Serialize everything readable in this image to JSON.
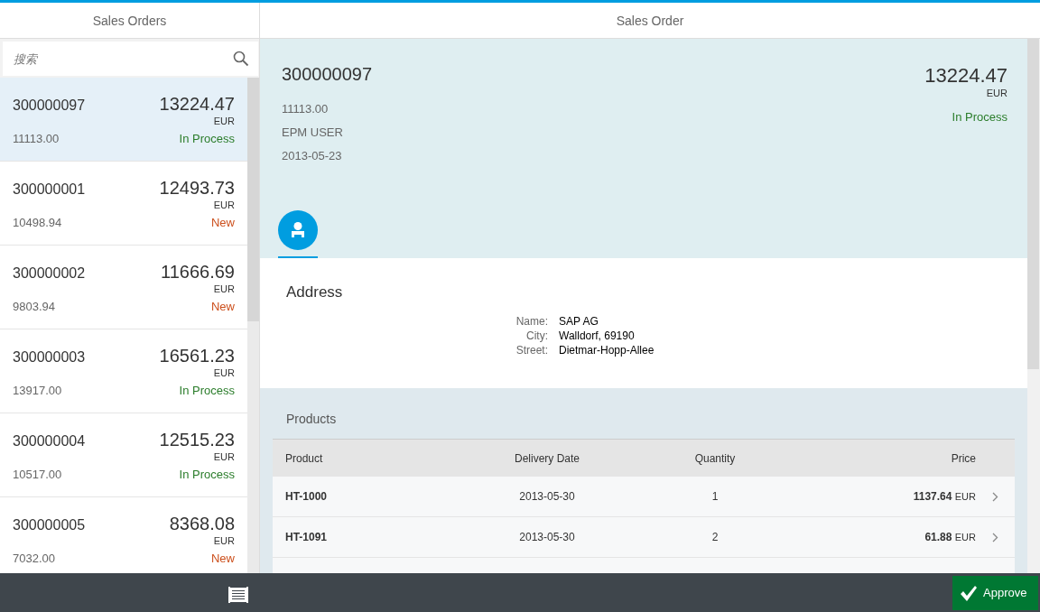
{
  "master": {
    "title": "Sales Orders",
    "search": {
      "placeholder": "搜索"
    },
    "items": [
      {
        "id": "300000097",
        "amount": "13224.47",
        "currency": "EUR",
        "net": "11113.00",
        "status": "In Process",
        "color": "#2b7d2b",
        "selected": true
      },
      {
        "id": "300000001",
        "amount": "12493.73",
        "currency": "EUR",
        "net": "10498.94",
        "status": "New",
        "color": "#cc4f1c",
        "selected": false
      },
      {
        "id": "300000002",
        "amount": "11666.69",
        "currency": "EUR",
        "net": "9803.94",
        "status": "New",
        "color": "#cc4f1c",
        "selected": false
      },
      {
        "id": "300000003",
        "amount": "16561.23",
        "currency": "EUR",
        "net": "13917.00",
        "status": "In Process",
        "color": "#2b7d2b",
        "selected": false
      },
      {
        "id": "300000004",
        "amount": "12515.23",
        "currency": "EUR",
        "net": "10517.00",
        "status": "In Process",
        "color": "#2b7d2b",
        "selected": false
      },
      {
        "id": "300000005",
        "amount": "8368.08",
        "currency": "EUR",
        "net": "7032.00",
        "status": "New",
        "color": "#cc4f1c",
        "selected": false
      }
    ]
  },
  "detail": {
    "title": "Sales Order",
    "header": {
      "id": "300000097",
      "amount": "13224.47",
      "currency": "EUR",
      "status": "In Process",
      "color": "#2b7d2b",
      "attributes": [
        "11113.00",
        "EPM USER",
        "2013-05-23"
      ]
    },
    "tabs": [
      {
        "kind": "contact",
        "selected": true
      }
    ],
    "address": {
      "title": "Address",
      "fields": [
        {
          "label": "Name:",
          "value": "SAP AG"
        },
        {
          "label": "City:",
          "value": "Walldorf, 69190"
        },
        {
          "label": "Street:",
          "value": "Dietmar-Hopp-Allee"
        }
      ]
    },
    "products": {
      "title": "Products",
      "columns": [
        "Product",
        "Delivery Date",
        "Quantity",
        "Price"
      ],
      "rows": [
        {
          "product": "HT-1000",
          "date": "2013-05-30",
          "quantity": "1",
          "price": "1137.64",
          "currency": "EUR"
        },
        {
          "product": "HT-1091",
          "date": "2013-05-30",
          "quantity": "2",
          "price": "61.88",
          "currency": "EUR"
        }
      ]
    }
  },
  "footer": {
    "buttons": [
      {
        "label": "Approve"
      }
    ]
  }
}
